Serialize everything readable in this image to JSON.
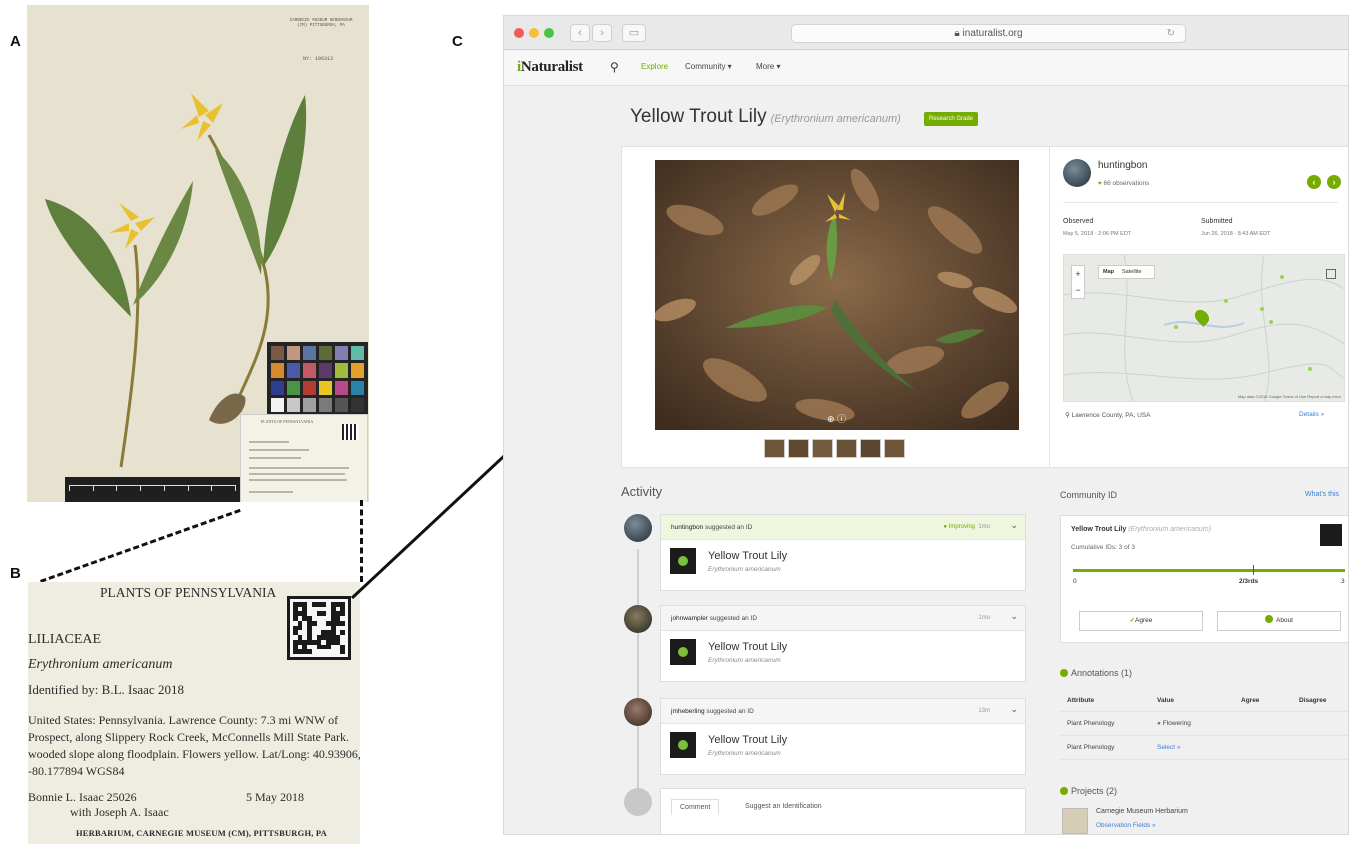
{
  "panel_letters": {
    "a": "A",
    "b": "B",
    "c": "C"
  },
  "herbarium_sheet": {
    "institution_label": "CARNEGIE MUSEUM HERBARIUM (CM) PITTSBURGH, PA",
    "accession": "NY: 106313",
    "mini_label_title": "PLANTS OF PENNSYLVANIA"
  },
  "label": {
    "title": "PLANTS OF PENNSYLVANIA",
    "family": "LILIACEAE",
    "scientific_name": "Erythronium americanum",
    "identified_by": "Identified by: B.L. Isaac 2018",
    "locality": "United States: Pennsylvania. Lawrence County: 7.3 mi WNW of Prospect, along Slippery Rock Creek, McConnells Mill State Park. wooded slope along floodplain. Flowers yellow. Lat/Long: 40.93906, -80.177894 WGS84",
    "collector": "Bonnie L. Isaac 25026",
    "date": "5 May 2018",
    "collector2": "with Joseph A. Isaac",
    "footer": "HERBARIUM, CARNEGIE MUSEUM (CM), PITTSBURGH, PA"
  },
  "browser": {
    "url": "inaturalist.org",
    "back_icon": "chevron-left-icon",
    "forward_icon": "chevron-right-icon",
    "reload_icon": "reload-icon"
  },
  "nav": {
    "logo_prefix": "i",
    "logo_rest": "Naturalist",
    "search_icon": "search-icon",
    "items": [
      "Explore",
      "Community ▾",
      "More ▾"
    ]
  },
  "observation": {
    "common_name": "Yellow Trout Lily",
    "scientific_name": "(Erythronium americanum)",
    "quality_grade": "Research Grade",
    "user": "huntingbon",
    "user_obs": "66 observations",
    "observed_label": "Observed",
    "observed_value": "May 5, 2018 · 2:06 PM EDT",
    "submitted_label": "Submitted",
    "submitted_value": "Jun 26, 2018 · 8:43 AM EDT",
    "map_types": [
      "Map",
      "Satellite"
    ],
    "map_credit": "Map data ©2018 Google   Terms of Use   Report a map error",
    "place": "Lawrence County, PA, USA",
    "details_link": "Details »"
  },
  "activity": {
    "heading": "Activity",
    "items": [
      {
        "user": "huntingbon",
        "action": "suggested an ID",
        "status": "Improving",
        "time": "1mo",
        "taxon": "Yellow Trout Lily",
        "taxon_sci": "Erythronium americanum"
      },
      {
        "user": "johnwampler",
        "action": "suggested an ID",
        "status": "",
        "time": "1mo",
        "taxon": "Yellow Trout Lily",
        "taxon_sci": "Erythronium americanum"
      },
      {
        "user": "jmheberling",
        "action": "suggested an ID",
        "status": "",
        "time": "13m",
        "taxon": "Yellow Trout Lily",
        "taxon_sci": "Erythronium americanum"
      }
    ],
    "comment_tab": "Comment",
    "suggest_tab": "Suggest an Identification"
  },
  "community_id": {
    "heading": "Community ID",
    "whats_this": "What's this",
    "taxon": "Yellow Trout Lily",
    "taxon_sci": "(Erythronium americanum)",
    "cumulative": "Cumulative IDs: 3 of 3",
    "scale_min": "0",
    "scale_mid": "2/3rds",
    "scale_max": "3",
    "agree_btn": "Agree",
    "about_btn": "About"
  },
  "annotations": {
    "heading": "Annotations (1)",
    "columns": [
      "Attribute",
      "Value",
      "Agree",
      "Disagree"
    ],
    "rows": [
      {
        "attribute": "Plant Phenology",
        "value": "Flowering"
      },
      {
        "attribute": "Plant Phenology",
        "value": "Select »"
      }
    ]
  },
  "projects": {
    "heading": "Projects (2)",
    "name": "Carnegie Museum Herbarium",
    "fields_link": "Observation Fields »"
  },
  "colors": {
    "accent": "#74ac00",
    "link": "#3a7fd5"
  }
}
